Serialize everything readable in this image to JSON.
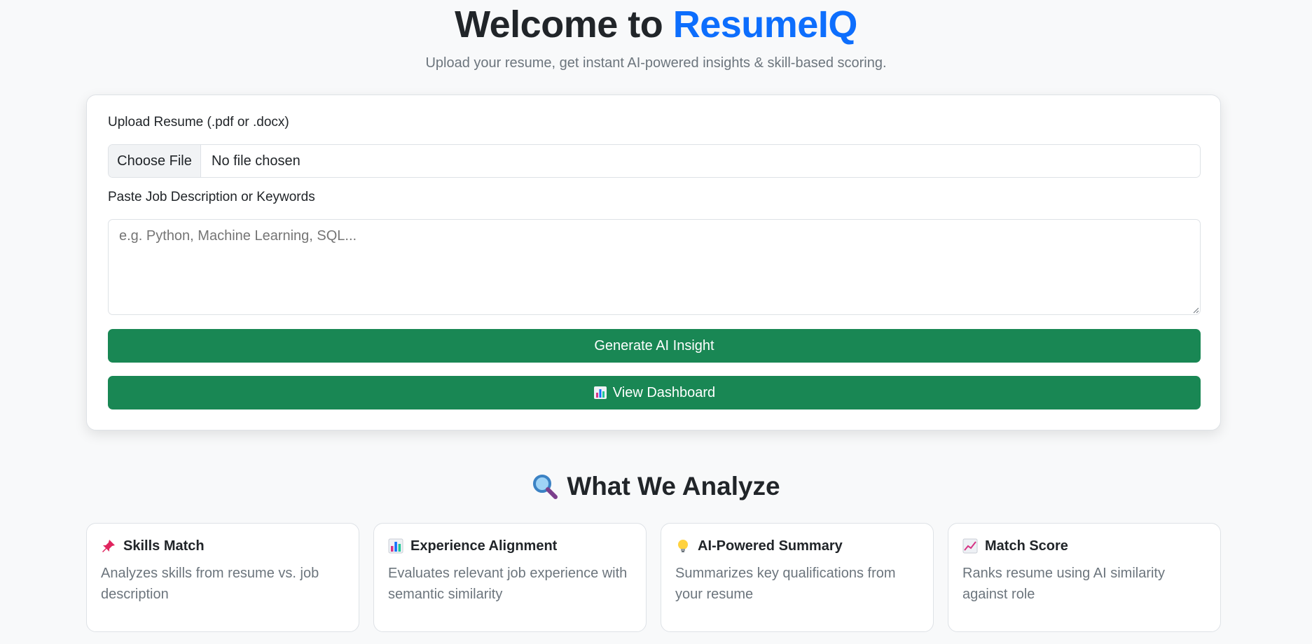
{
  "hero": {
    "title_prefix": "Welcome to ",
    "title_brand": "ResumeIQ",
    "subtitle": "Upload your resume, get instant AI-powered insights & skill-based scoring."
  },
  "form": {
    "upload_label": "Upload Resume (.pdf or .docx)",
    "file_button": "Choose File",
    "file_status": "No file chosen",
    "jd_label": "Paste Job Description or Keywords",
    "jd_placeholder": "e.g. Python, Machine Learning, SQL...",
    "generate_button": "Generate AI Insight",
    "dashboard_button": "View Dashboard"
  },
  "analyze": {
    "title": "What We Analyze",
    "features": [
      {
        "icon": "pushpin-icon",
        "title": "Skills Match",
        "text": "Analyzes skills from resume vs. job description"
      },
      {
        "icon": "bar-chart-icon",
        "title": "Experience Alignment",
        "text": "Evaluates relevant job experience with semantic similarity"
      },
      {
        "icon": "lightbulb-icon",
        "title": "AI-Powered Summary",
        "text": "Summarizes key qualifications from your resume"
      },
      {
        "icon": "trend-up-icon",
        "title": "Match Score",
        "text": "Ranks resume using AI similarity against role"
      }
    ]
  },
  "colors": {
    "brand": "#0d6efd",
    "primary_button": "#198754",
    "background": "#f8f9fa"
  }
}
